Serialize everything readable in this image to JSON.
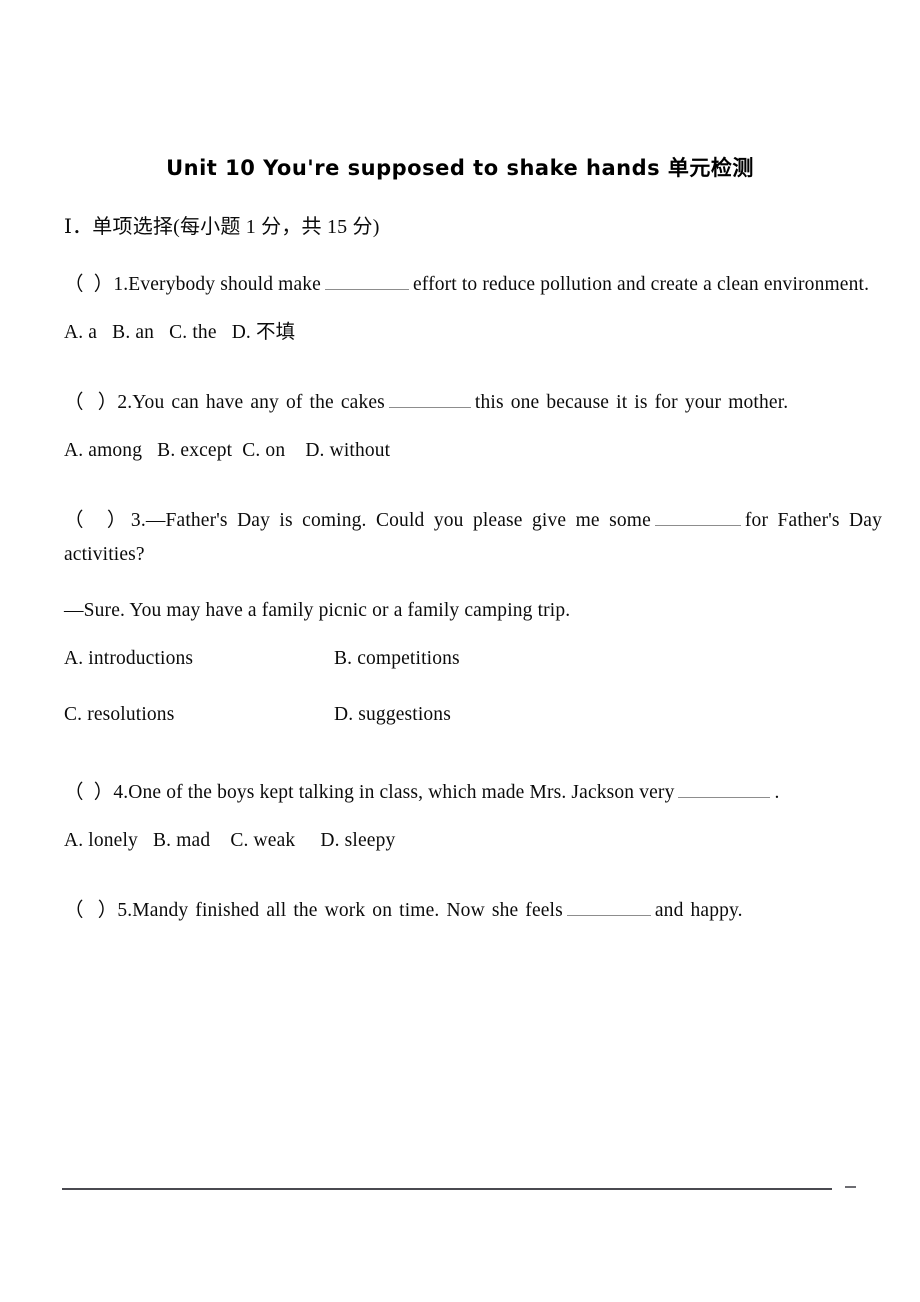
{
  "document": {
    "title": "Unit 10 You're supposed to shake hands 单元检测",
    "section_heading": "Ⅰ．单项选择(每小题 1 分，共 15 分)"
  },
  "questions": [
    {
      "number": "1",
      "tag": "（  ）1.",
      "stem_part1": "Everybody should make",
      "stem_part2": "effort to reduce pollution and create a clean environment.",
      "options_line": "A. a   B. an   C. the   D. 不填"
    },
    {
      "number": "2",
      "tag": "（  ）2.",
      "stem_part1": "You can have any of the cakes",
      "stem_part2": "this one because it is for your mother.",
      "options_line": "A. among   B. except  C. on    D. without"
    },
    {
      "number": "3",
      "tag": "（  ）3.",
      "stem_part1": "—Father's Day is coming. Could you please give me some",
      "stem_part2": "for Father's Day activities?",
      "answer_line": "—Sure. You may have a family picnic or a family camping trip.",
      "options_grid": [
        [
          "A. introductions",
          "B. competitions"
        ],
        [
          "C. resolutions",
          "D. suggestions"
        ]
      ]
    },
    {
      "number": "4",
      "tag": "（  ）4.",
      "stem_part1": "One of the boys kept talking in class, which made Mrs. Jackson very",
      "stem_part2": ".",
      "options_line": "A. lonely   B. mad    C. weak     D. sleepy"
    },
    {
      "number": "5",
      "tag": "（  ）5.",
      "stem_part1": "Mandy finished all the work on time. Now she feels",
      "stem_part2": "and happy."
    }
  ]
}
